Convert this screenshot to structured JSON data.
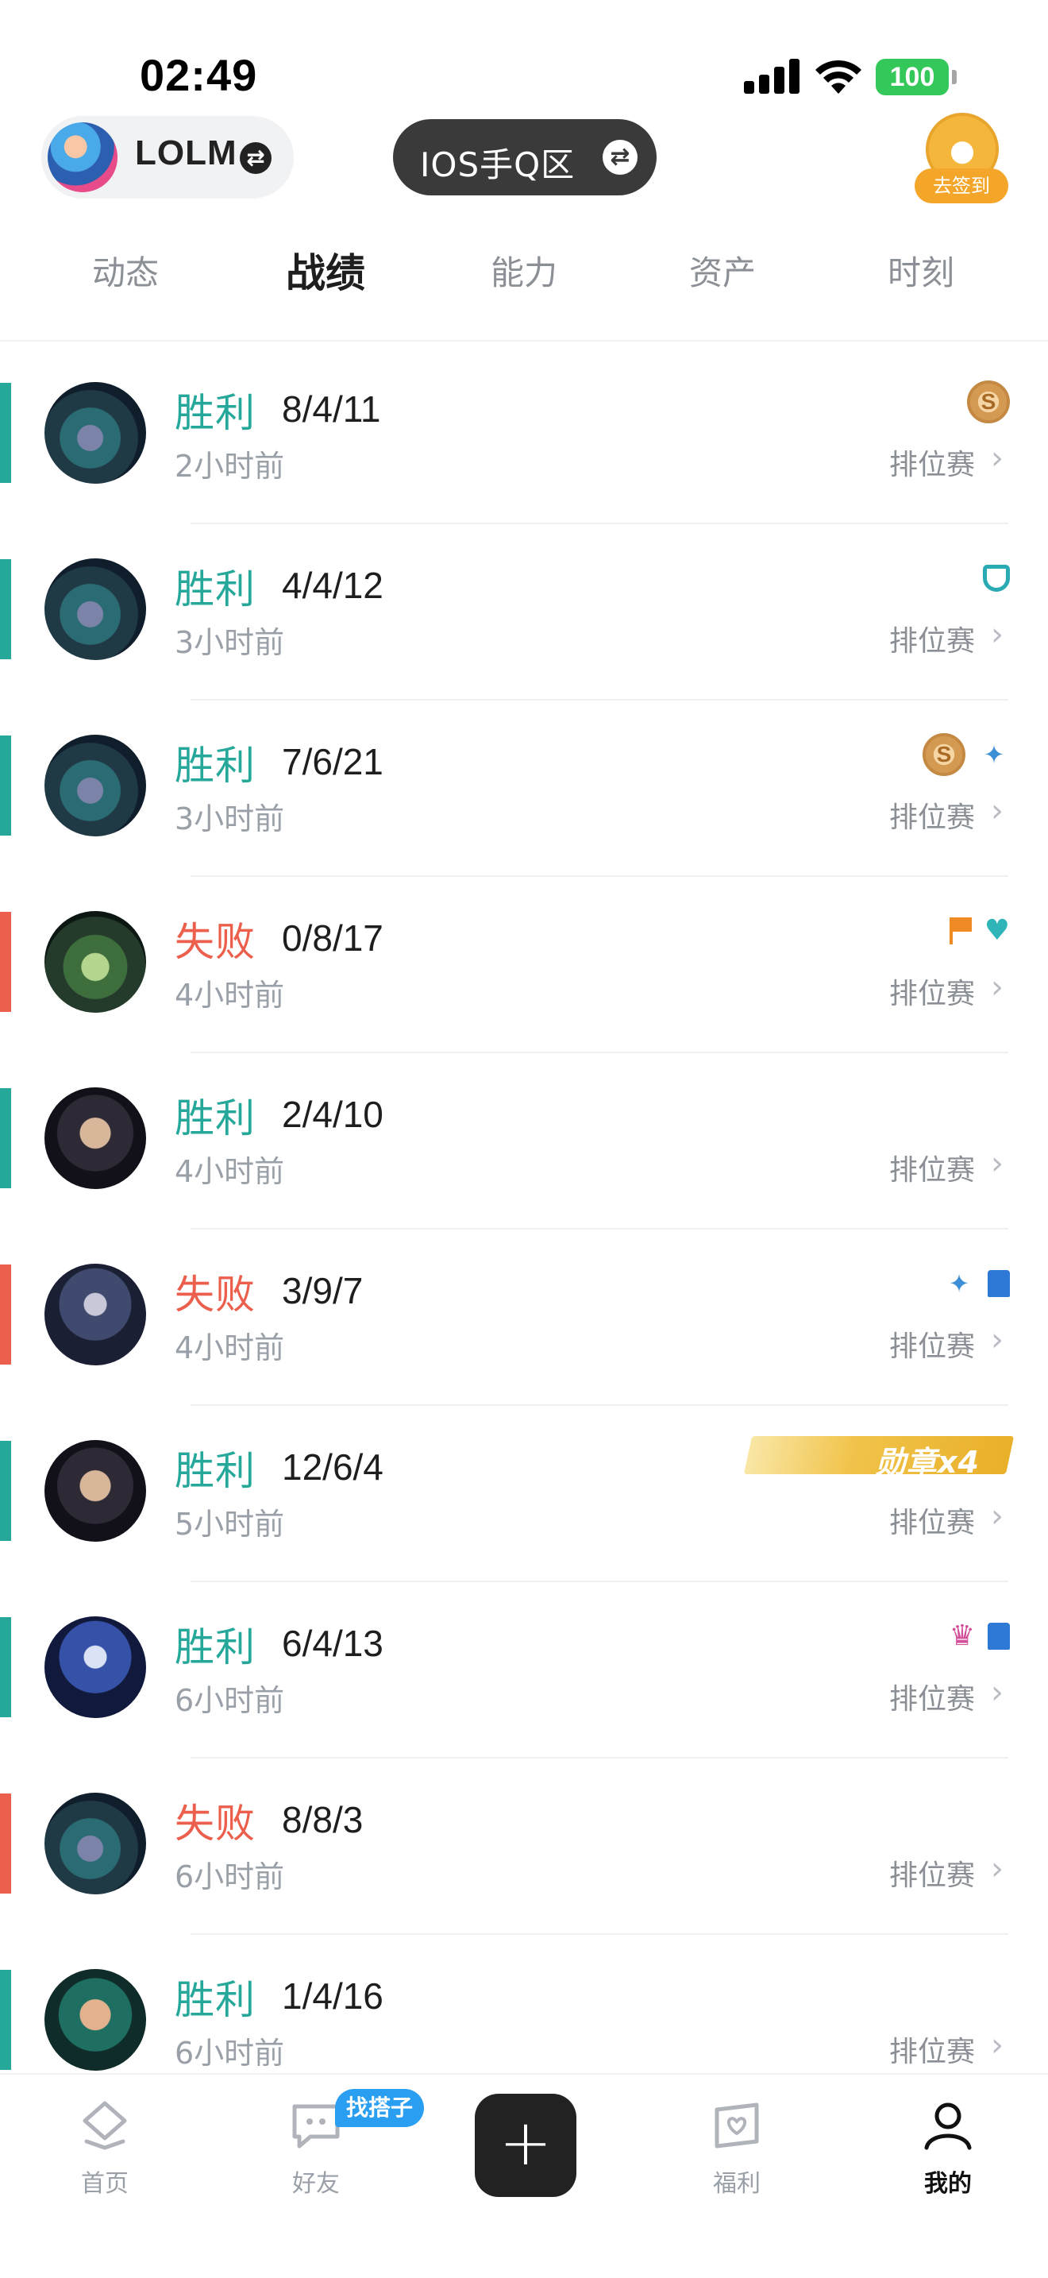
{
  "status_bar": {
    "time": "02:49",
    "battery": "100"
  },
  "header": {
    "account_name": "LOLM",
    "region": "IOS手Q区",
    "checkin_label": "去签到"
  },
  "tabs": [
    {
      "label": "动态",
      "active": false
    },
    {
      "label": "战绩",
      "active": true
    },
    {
      "label": "能力",
      "active": false
    },
    {
      "label": "资产",
      "active": false
    },
    {
      "label": "时刻",
      "active": false
    }
  ],
  "matches": [
    {
      "result": "胜利",
      "outcome": "win",
      "kda": "8/4/11",
      "time": "2小时前",
      "mode": "排位赛",
      "icons": [
        "coin-icon"
      ]
    },
    {
      "result": "胜利",
      "outcome": "win",
      "kda": "4/4/12",
      "time": "3小时前",
      "mode": "排位赛",
      "icons": [
        "shield-icon"
      ]
    },
    {
      "result": "胜利",
      "outcome": "win",
      "kda": "7/6/21",
      "time": "3小时前",
      "mode": "排位赛",
      "icons": [
        "coin-icon",
        "wings-icon"
      ]
    },
    {
      "result": "失败",
      "outcome": "lose",
      "kda": "0/8/17",
      "time": "4小时前",
      "mode": "排位赛",
      "icons": [
        "flag-icon",
        "heart-plus-icon"
      ]
    },
    {
      "result": "胜利",
      "outcome": "win",
      "kda": "2/4/10",
      "time": "4小时前",
      "mode": "排位赛",
      "icons": []
    },
    {
      "result": "失败",
      "outcome": "lose",
      "kda": "3/9/7",
      "time": "4小时前",
      "mode": "排位赛",
      "icons": [
        "wings-icon",
        "tower-icon"
      ]
    },
    {
      "result": "胜利",
      "outcome": "win",
      "kda": "12/6/4",
      "time": "5小时前",
      "mode": "排位赛",
      "icons": [],
      "medal": "勋章x4"
    },
    {
      "result": "胜利",
      "outcome": "win",
      "kda": "6/4/13",
      "time": "6小时前",
      "mode": "排位赛",
      "icons": [
        "demon-icon",
        "tower-icon"
      ]
    },
    {
      "result": "失败",
      "outcome": "lose",
      "kda": "8/8/3",
      "time": "6小时前",
      "mode": "排位赛",
      "icons": []
    },
    {
      "result": "胜利",
      "outcome": "win",
      "kda": "1/4/16",
      "time": "6小时前",
      "mode": "排位赛",
      "icons": []
    }
  ],
  "bottom_nav": {
    "items": [
      {
        "label": "首页",
        "icon": "home-icon"
      },
      {
        "label": "好友",
        "icon": "chat-icon"
      },
      {
        "label": "福利",
        "icon": "gift-heart-icon"
      },
      {
        "label": "我的",
        "icon": "profile-icon"
      }
    ],
    "badge": "找搭子"
  },
  "colors": {
    "win": "#25a89a",
    "lose": "#ec5f4c",
    "accent": "#2a9ef0"
  }
}
